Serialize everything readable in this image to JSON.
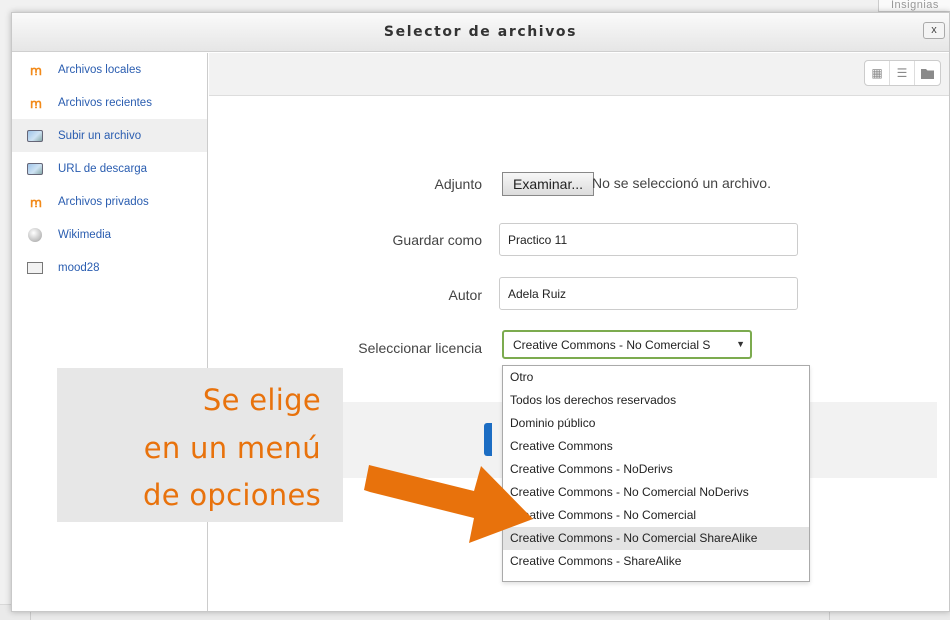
{
  "background": {
    "top_tab": "Insignias"
  },
  "dialog": {
    "title": "Selector de archivos",
    "close_label": "x"
  },
  "sidebar": {
    "items": [
      {
        "label": "Archivos locales",
        "icon": "moodle-icon"
      },
      {
        "label": "Archivos recientes",
        "icon": "moodle-icon"
      },
      {
        "label": "Subir un archivo",
        "icon": "upload-icon",
        "active": true
      },
      {
        "label": "URL de descarga",
        "icon": "upload-icon"
      },
      {
        "label": "Archivos privados",
        "icon": "moodle-icon"
      },
      {
        "label": "Wikimedia",
        "icon": "wikimedia-icon"
      },
      {
        "label": "mood28",
        "icon": "disk-icon"
      }
    ]
  },
  "toolbar": {
    "view_buttons": [
      "grid-view-icon",
      "list-view-icon",
      "folder-view-icon"
    ]
  },
  "form": {
    "attachment_label": "Adjunto",
    "browse_button": "Examinar...",
    "no_file_text": "No se seleccionó un archivo.",
    "save_as_label": "Guardar como",
    "save_as_value": "Practico 11",
    "author_label": "Autor",
    "author_value": "Adela Ruiz",
    "license_label": "Seleccionar licencia",
    "license_selected": "Creative Commons - No Comercial S"
  },
  "license_options": [
    "Otro",
    "Todos los derechos reservados",
    "Dominio público",
    "Creative Commons",
    "Creative Commons - NoDerivs",
    "Creative Commons - No Comercial NoDerivs",
    "Creative Commons - No Comercial",
    "Creative Commons - No Comercial ShareAlike",
    "Creative Commons - ShareAlike"
  ],
  "highlighted_option_index": 7,
  "annotation": {
    "lines": [
      "Se elige",
      "en un menú",
      "de opciones"
    ],
    "color": "#e8720c"
  }
}
